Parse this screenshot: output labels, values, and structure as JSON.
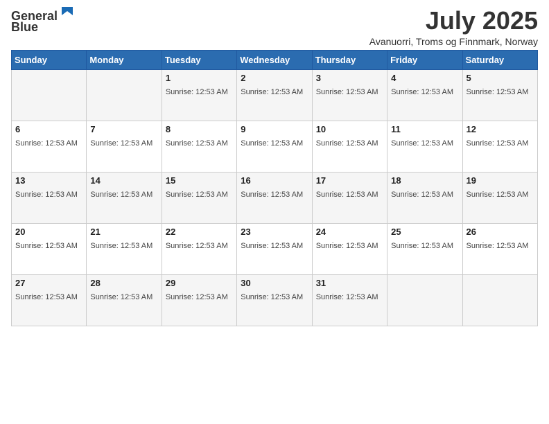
{
  "header": {
    "logo_line1": "General",
    "logo_line2": "Blue",
    "month_title": "July 2025",
    "location": "Avanuorri, Troms og Finnmark, Norway"
  },
  "days_of_week": [
    "Sunday",
    "Monday",
    "Tuesday",
    "Wednesday",
    "Thursday",
    "Friday",
    "Saturday"
  ],
  "sunrise_time": "Sunrise: 12:53 AM",
  "weeks": [
    [
      {
        "day": "",
        "sunrise": ""
      },
      {
        "day": "",
        "sunrise": ""
      },
      {
        "day": "1",
        "sunrise": "Sunrise: 12:53 AM"
      },
      {
        "day": "2",
        "sunrise": "Sunrise: 12:53 AM"
      },
      {
        "day": "3",
        "sunrise": "Sunrise: 12:53 AM"
      },
      {
        "day": "4",
        "sunrise": "Sunrise: 12:53 AM"
      },
      {
        "day": "5",
        "sunrise": "Sunrise: 12:53 AM"
      }
    ],
    [
      {
        "day": "6",
        "sunrise": "Sunrise: 12:53 AM"
      },
      {
        "day": "7",
        "sunrise": "Sunrise: 12:53 AM"
      },
      {
        "day": "8",
        "sunrise": "Sunrise: 12:53 AM"
      },
      {
        "day": "9",
        "sunrise": "Sunrise: 12:53 AM"
      },
      {
        "day": "10",
        "sunrise": "Sunrise: 12:53 AM"
      },
      {
        "day": "11",
        "sunrise": "Sunrise: 12:53 AM"
      },
      {
        "day": "12",
        "sunrise": "Sunrise: 12:53 AM"
      }
    ],
    [
      {
        "day": "13",
        "sunrise": "Sunrise: 12:53 AM"
      },
      {
        "day": "14",
        "sunrise": "Sunrise: 12:53 AM"
      },
      {
        "day": "15",
        "sunrise": "Sunrise: 12:53 AM"
      },
      {
        "day": "16",
        "sunrise": "Sunrise: 12:53 AM"
      },
      {
        "day": "17",
        "sunrise": "Sunrise: 12:53 AM"
      },
      {
        "day": "18",
        "sunrise": "Sunrise: 12:53 AM"
      },
      {
        "day": "19",
        "sunrise": "Sunrise: 12:53 AM"
      }
    ],
    [
      {
        "day": "20",
        "sunrise": "Sunrise: 12:53 AM"
      },
      {
        "day": "21",
        "sunrise": "Sunrise: 12:53 AM"
      },
      {
        "day": "22",
        "sunrise": "Sunrise: 12:53 AM"
      },
      {
        "day": "23",
        "sunrise": "Sunrise: 12:53 AM"
      },
      {
        "day": "24",
        "sunrise": "Sunrise: 12:53 AM"
      },
      {
        "day": "25",
        "sunrise": "Sunrise: 12:53 AM"
      },
      {
        "day": "26",
        "sunrise": "Sunrise: 12:53 AM"
      }
    ],
    [
      {
        "day": "27",
        "sunrise": "Sunrise: 12:53 AM"
      },
      {
        "day": "28",
        "sunrise": "Sunrise: 12:53 AM"
      },
      {
        "day": "29",
        "sunrise": "Sunrise: 12:53 AM"
      },
      {
        "day": "30",
        "sunrise": "Sunrise: 12:53 AM"
      },
      {
        "day": "31",
        "sunrise": "Sunrise: 12:53 AM"
      },
      {
        "day": "",
        "sunrise": ""
      },
      {
        "day": "",
        "sunrise": ""
      }
    ]
  ]
}
